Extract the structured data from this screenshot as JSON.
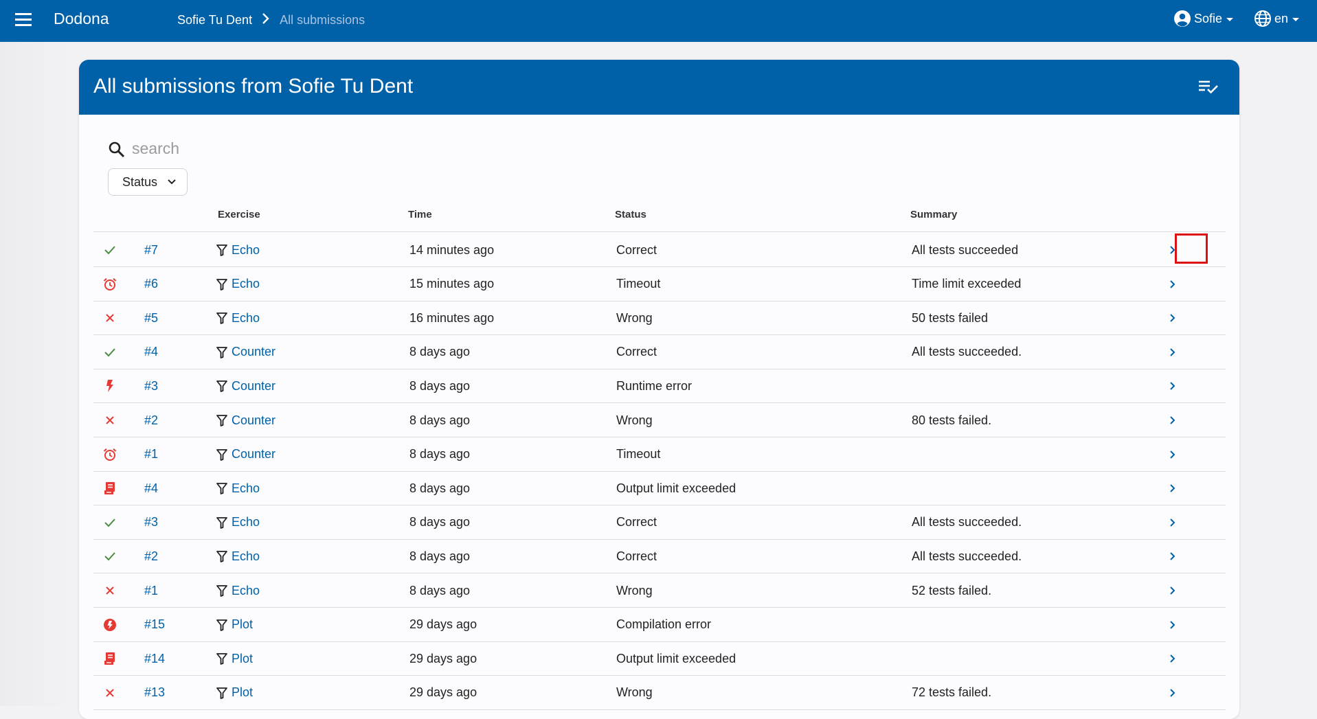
{
  "topbar": {
    "brand": "Dodona",
    "breadcrumb": {
      "parent": "Sofie Tu Dent",
      "current": "All submissions"
    },
    "user": "Sofie",
    "language": "en"
  },
  "card": {
    "title": "All submissions from Sofie Tu Dent",
    "action_icon": "playlist-check-icon"
  },
  "search": {
    "placeholder": "search"
  },
  "filters": {
    "status_label": "Status"
  },
  "table": {
    "headers": {
      "exercise": "Exercise",
      "time": "Time",
      "status": "Status",
      "summary": "Summary"
    },
    "rows": [
      {
        "icon": "check",
        "num": "#7",
        "exercise": "Echo",
        "time": "14 minutes ago",
        "status": "Correct",
        "summary": "All tests succeeded"
      },
      {
        "icon": "alarm",
        "num": "#6",
        "exercise": "Echo",
        "time": "15 minutes ago",
        "status": "Timeout",
        "summary": "Time limit exceeded"
      },
      {
        "icon": "close",
        "num": "#5",
        "exercise": "Echo",
        "time": "16 minutes ago",
        "status": "Wrong",
        "summary": "50 tests failed"
      },
      {
        "icon": "check",
        "num": "#4",
        "exercise": "Counter",
        "time": "8 days ago",
        "status": "Correct",
        "summary": "All tests succeeded."
      },
      {
        "icon": "flash",
        "num": "#3",
        "exercise": "Counter",
        "time": "8 days ago",
        "status": "Runtime error",
        "summary": ""
      },
      {
        "icon": "close",
        "num": "#2",
        "exercise": "Counter",
        "time": "8 days ago",
        "status": "Wrong",
        "summary": "80 tests failed."
      },
      {
        "icon": "alarm",
        "num": "#1",
        "exercise": "Counter",
        "time": "8 days ago",
        "status": "Timeout",
        "summary": ""
      },
      {
        "icon": "script",
        "num": "#4",
        "exercise": "Echo",
        "time": "8 days ago",
        "status": "Output limit exceeded",
        "summary": ""
      },
      {
        "icon": "check",
        "num": "#3",
        "exercise": "Echo",
        "time": "8 days ago",
        "status": "Correct",
        "summary": "All tests succeeded."
      },
      {
        "icon": "check",
        "num": "#2",
        "exercise": "Echo",
        "time": "8 days ago",
        "status": "Correct",
        "summary": "All tests succeeded."
      },
      {
        "icon": "close",
        "num": "#1",
        "exercise": "Echo",
        "time": "8 days ago",
        "status": "Wrong",
        "summary": "52 tests failed."
      },
      {
        "icon": "flash-circle",
        "num": "#15",
        "exercise": "Plot",
        "time": "29 days ago",
        "status": "Compilation error",
        "summary": ""
      },
      {
        "icon": "script",
        "num": "#14",
        "exercise": "Plot",
        "time": "29 days ago",
        "status": "Output limit exceeded",
        "summary": ""
      },
      {
        "icon": "close",
        "num": "#13",
        "exercise": "Plot",
        "time": "29 days ago",
        "status": "Wrong",
        "summary": "72 tests failed."
      }
    ]
  },
  "colors": {
    "primary": "#0061a8",
    "correct": "#4a8d3e",
    "error": "#e53935",
    "highlight": "#dd1111"
  }
}
